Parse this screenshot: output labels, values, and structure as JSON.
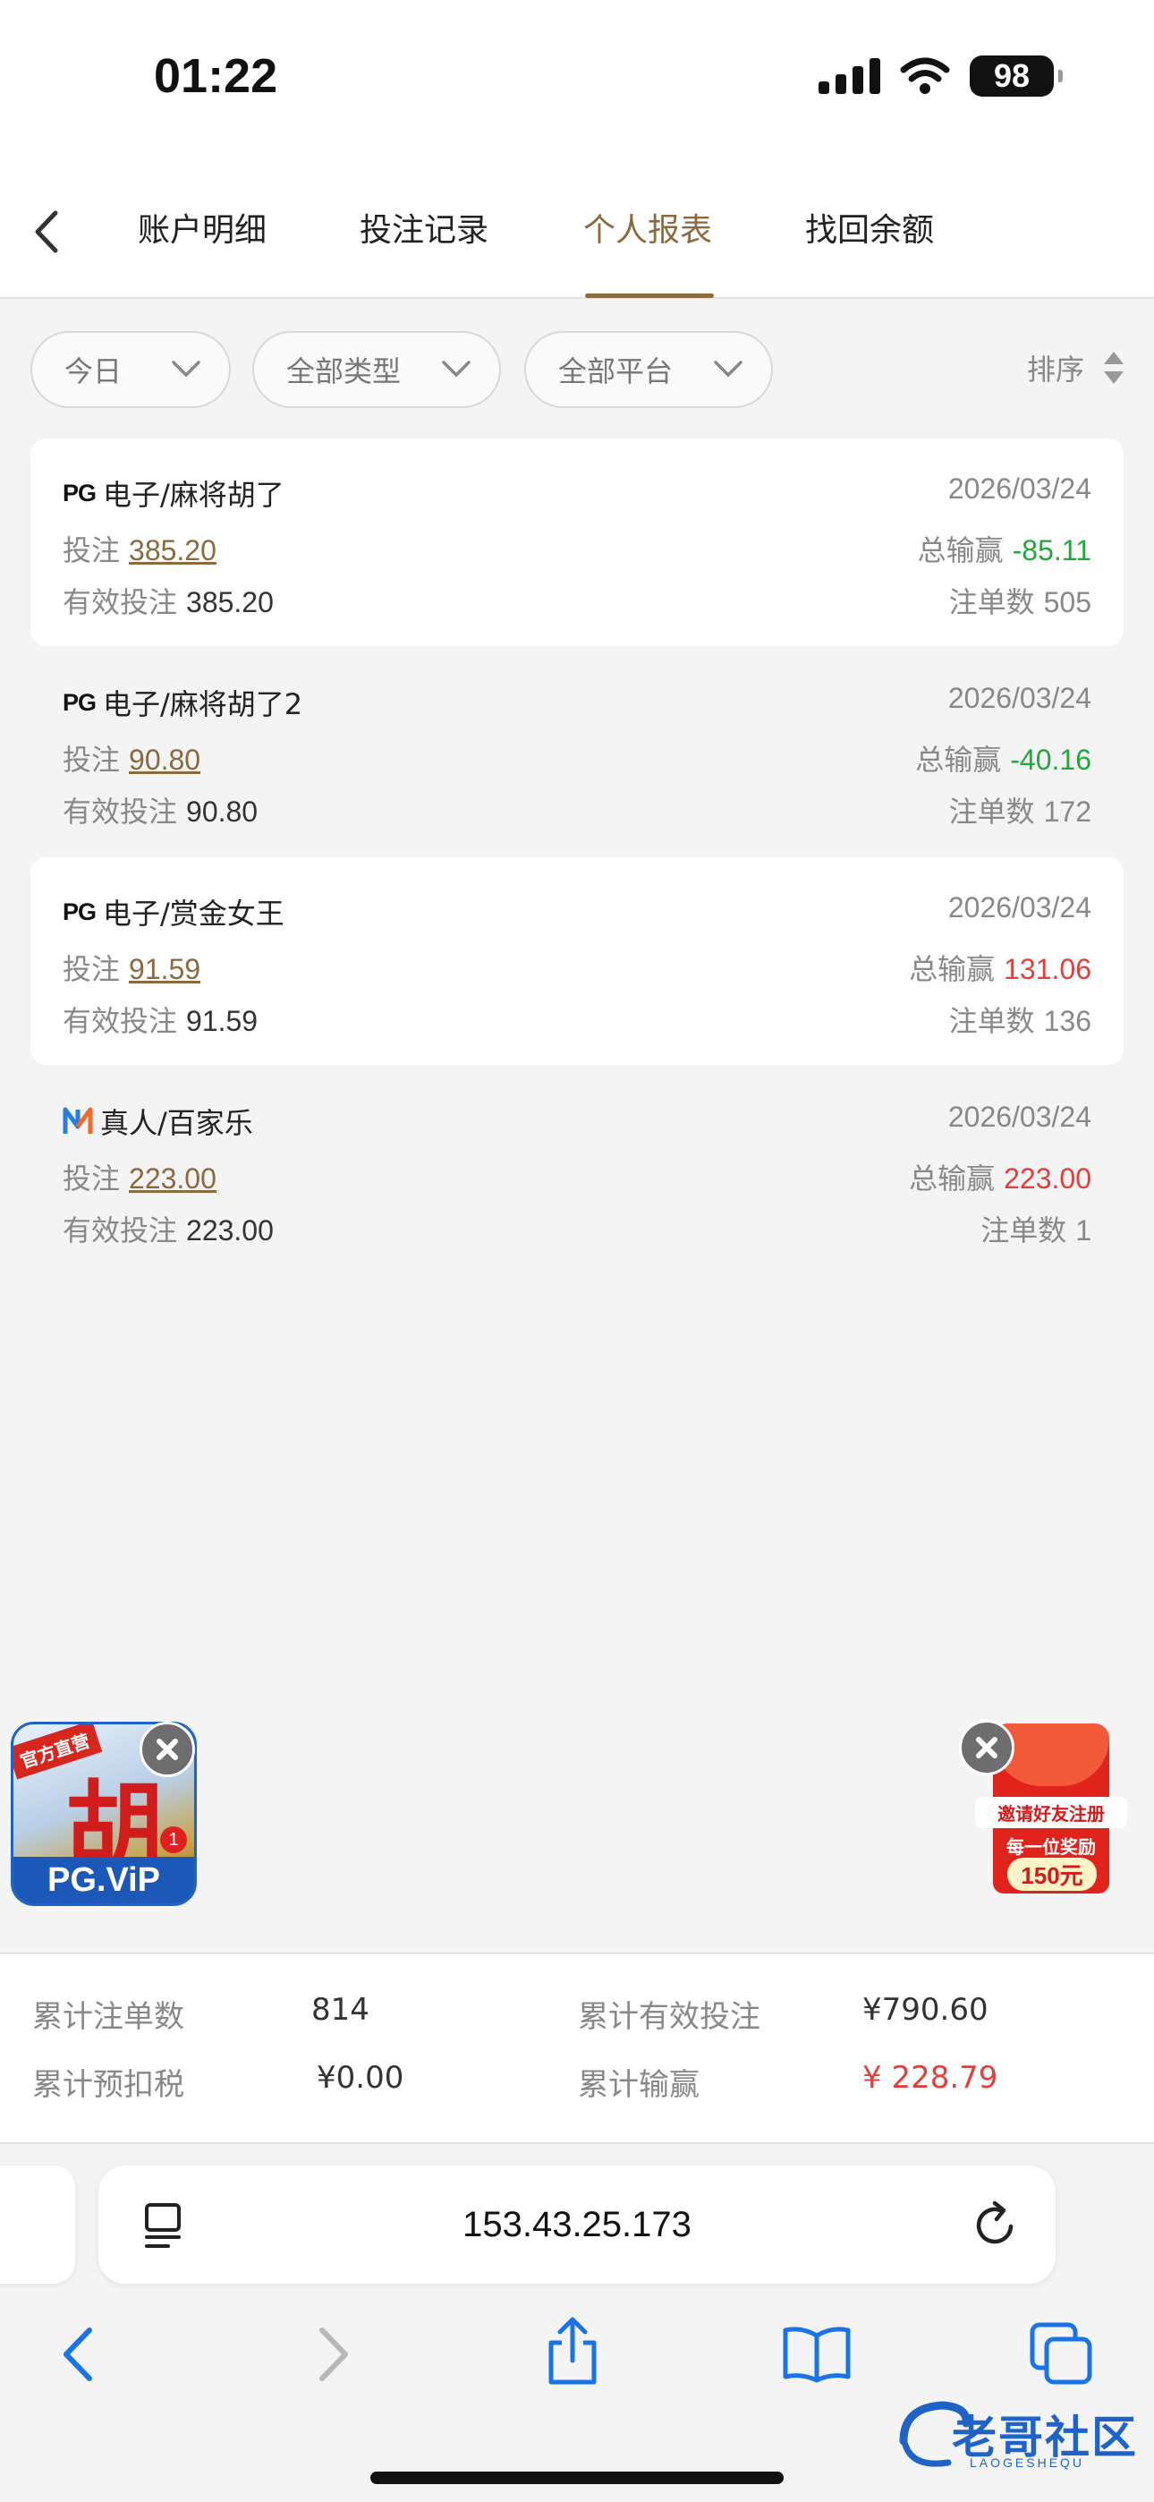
{
  "status": {
    "time": "01:22",
    "battery": "98"
  },
  "tabs": [
    {
      "label": "账户明细"
    },
    {
      "label": "投注记录"
    },
    {
      "label": "个人报表"
    },
    {
      "label": "找回余额"
    }
  ],
  "active_tab": "个人报表",
  "filters": {
    "date": "今日",
    "type": "全部类型",
    "platform": "全部平台",
    "sort": "排序"
  },
  "labels": {
    "bet": "投注",
    "total_winloss": "总输赢",
    "valid_bet": "有效投注",
    "order_count": "注单数"
  },
  "records": [
    {
      "logo": "PG",
      "title": "电子/麻将胡了",
      "date": "2026/03/24",
      "bet": "385.20",
      "winloss": "-85.11",
      "valid": "385.20",
      "count": "505"
    },
    {
      "logo": "PG",
      "title": "电子/麻将胡了2",
      "date": "2026/03/24",
      "bet": "90.80",
      "winloss": "-40.16",
      "valid": "90.80",
      "count": "172"
    },
    {
      "logo": "PG",
      "title": "电子/赏金女王",
      "date": "2026/03/24",
      "bet": "91.59",
      "winloss": "131.06",
      "valid": "91.59",
      "count": "136"
    },
    {
      "logo": "live",
      "title": "真人/百家乐",
      "date": "2026/03/24",
      "bet": "223.00",
      "winloss": "223.00",
      "valid": "223.00",
      "count": "1"
    }
  ],
  "promos": {
    "left": {
      "ribbon": "官方直营",
      "char": "胡",
      "brand": "PG.ViP",
      "badge": "1"
    },
    "right": {
      "line1": "邀请好友注册",
      "line2": "每一位奖励",
      "line3": "150元"
    }
  },
  "summary": {
    "total_orders_label": "累计注单数",
    "total_orders": "814",
    "total_valid_label": "累计有效投注",
    "total_valid": "¥790.60",
    "tax_label": "累计预扣税",
    "tax": "¥0.00",
    "winloss_label": "累计输赢",
    "winloss": "¥ 228.79"
  },
  "browser": {
    "url": "153.43.25.173"
  },
  "watermark": {
    "text": "老哥社区",
    "sub": "LAOGESHEQU"
  },
  "colors": {
    "accent": "#8b6a3e",
    "loss": "#22a83a",
    "win": "#e0403a"
  }
}
